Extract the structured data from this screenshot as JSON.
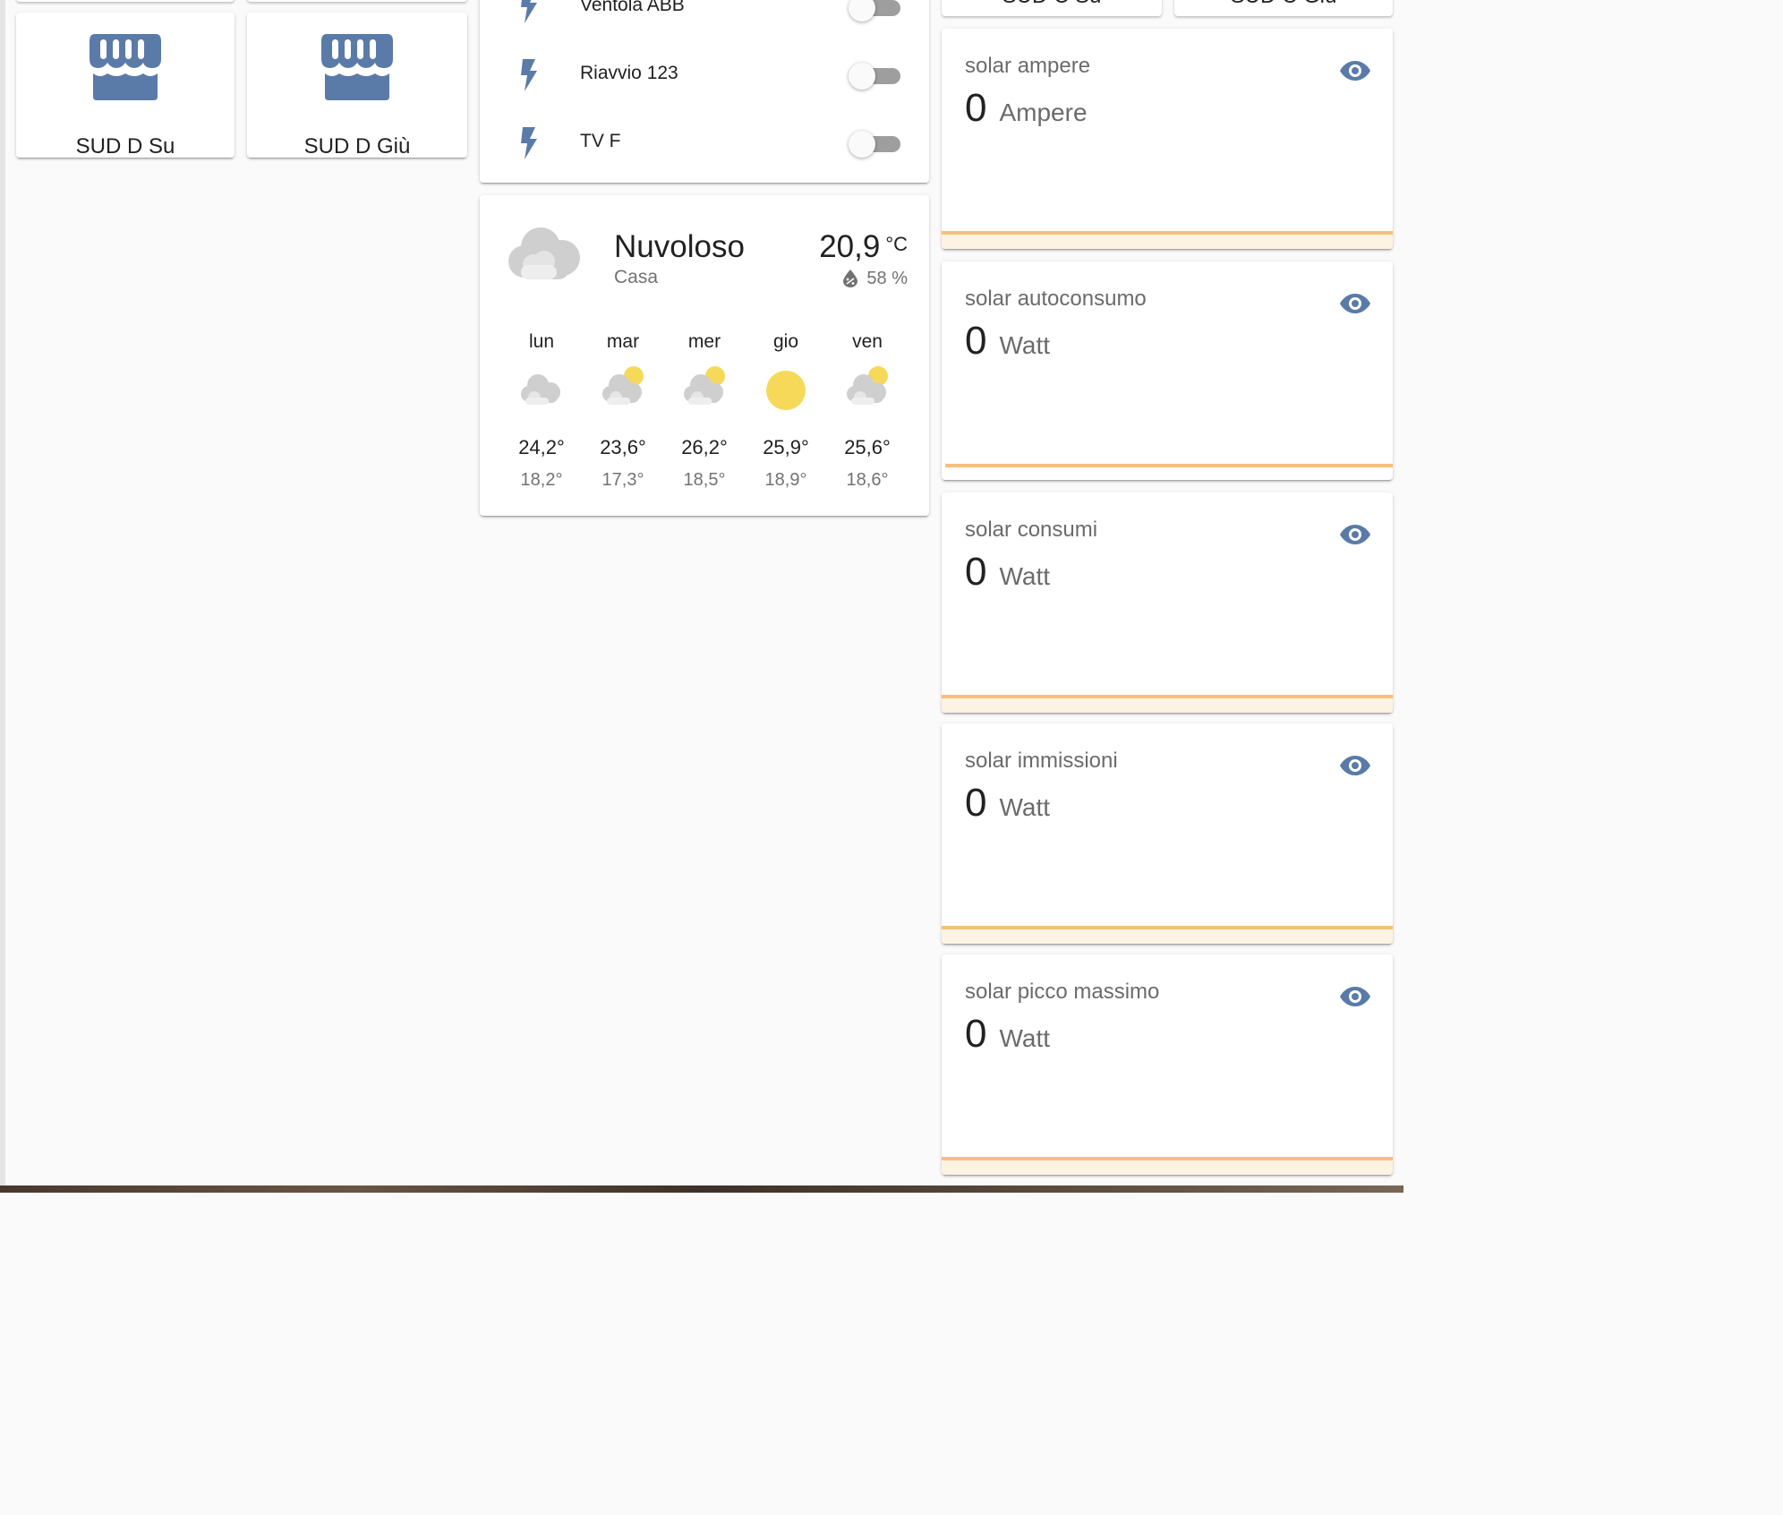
{
  "colors": {
    "icon_blue": "#5a7ba8",
    "sun_yellow": "#f7d959",
    "cloud_gray": "#d5d5d5",
    "gauge_orange": "#f7c07a",
    "gauge_bg": "#fdf3e3"
  },
  "covers": [
    {
      "name": "SUD D Su",
      "icon": "storefront-icon"
    },
    {
      "name": "SUD D Giù",
      "icon": "storefront-icon"
    }
  ],
  "covers_top_right": [
    {
      "name": "SUD C Su"
    },
    {
      "name": "SUD C Giù"
    }
  ],
  "switches": {
    "items": [
      {
        "name": "Ventola ABB",
        "icon": "flash-icon",
        "state": "off"
      },
      {
        "name": "Riavvio 123",
        "icon": "flash-icon",
        "state": "off"
      },
      {
        "name": "TV F",
        "icon": "flash-icon",
        "state": "off"
      }
    ]
  },
  "weather": {
    "condition": "Nuvoloso",
    "location": "Casa",
    "temperature": "20,9",
    "temperature_unit": "°C",
    "humidity": "58 %",
    "forecast": [
      {
        "day": "lun",
        "icon": "cloudy-icon",
        "high": "24,2°",
        "low": "18,2°"
      },
      {
        "day": "mar",
        "icon": "partly-cloudy-icon",
        "high": "23,6°",
        "low": "17,3°"
      },
      {
        "day": "mer",
        "icon": "partly-cloudy-icon",
        "high": "26,2°",
        "low": "18,5°"
      },
      {
        "day": "gio",
        "icon": "sunny-icon",
        "high": "25,9°",
        "low": "18,9°"
      },
      {
        "day": "ven",
        "icon": "partly-cloudy-icon",
        "high": "25,6°",
        "low": "18,6°"
      }
    ]
  },
  "sensors": [
    {
      "name": "solar ampere",
      "value": "0",
      "unit": "Ampere",
      "icon": "eye-icon"
    },
    {
      "name": "solar autoconsumo",
      "value": "0",
      "unit": "Watt",
      "icon": "eye-icon"
    },
    {
      "name": "solar consumi",
      "value": "0",
      "unit": "Watt",
      "icon": "eye-icon"
    },
    {
      "name": "solar immissioni",
      "value": "0",
      "unit": "Watt",
      "icon": "eye-icon"
    },
    {
      "name": "solar picco massimo",
      "value": "0",
      "unit": "Watt",
      "icon": "eye-icon"
    }
  ]
}
